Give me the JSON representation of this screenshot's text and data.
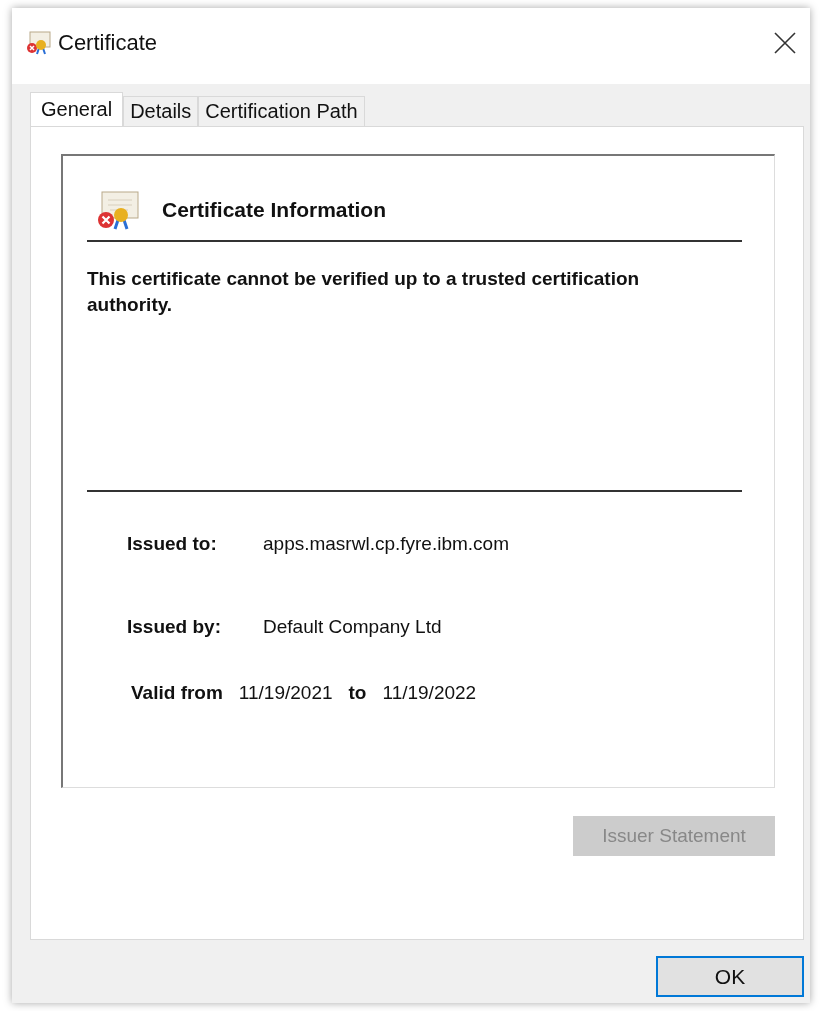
{
  "window": {
    "title": "Certificate"
  },
  "tabs": [
    {
      "label": "General",
      "selected": true
    },
    {
      "label": "Details",
      "selected": false
    },
    {
      "label": "Certification Path",
      "selected": false
    }
  ],
  "info": {
    "heading": "Certificate Information",
    "message": "This certificate cannot be verified up to a trusted certification authority."
  },
  "fields": [
    {
      "label": "Issued to:",
      "value": "apps.masrwl.cp.fyre.ibm.com"
    },
    {
      "label": "Issued by:",
      "value": "Default Company Ltd"
    }
  ],
  "validity": {
    "label": "Valid from",
    "from": "11/19/2021",
    "to_label": "to",
    "to": "11/19/2022"
  },
  "issuer_statement": {
    "label": "Issuer Statement",
    "disabled": true
  },
  "ok_button": {
    "label": "OK"
  }
}
